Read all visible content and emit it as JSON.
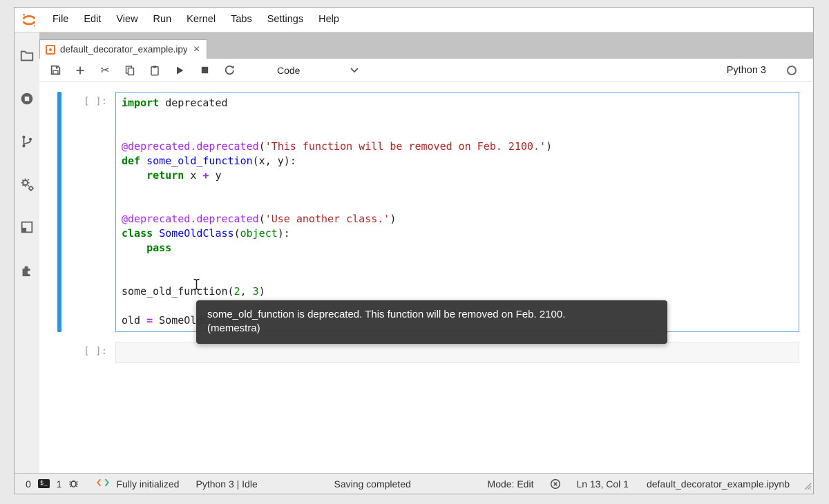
{
  "menubar": {
    "items": [
      "File",
      "Edit",
      "View",
      "Run",
      "Kernel",
      "Tabs",
      "Settings",
      "Help"
    ]
  },
  "tab": {
    "title": "default_decorator_example.ipynb",
    "close_label": "×"
  },
  "toolbar": {
    "cell_type": "Code",
    "kernel_name": "Python 3"
  },
  "cells": [
    {
      "prompt": "[ ]:",
      "lines": [
        [
          {
            "c": "kw",
            "v": "import"
          },
          {
            "c": "p",
            "v": " deprecated"
          }
        ],
        [],
        [],
        [
          {
            "c": "meta",
            "v": "@deprecated.deprecated"
          },
          {
            "c": "p",
            "v": "("
          },
          {
            "c": "str",
            "v": "'This function will be removed on Feb. 2100.'"
          },
          {
            "c": "p",
            "v": ")"
          }
        ],
        [
          {
            "c": "kw",
            "v": "def"
          },
          {
            "c": "p",
            "v": " "
          },
          {
            "c": "fn",
            "v": "some_old_function"
          },
          {
            "c": "p",
            "v": "(x, y):"
          }
        ],
        [
          {
            "c": "p",
            "v": "    "
          },
          {
            "c": "kw",
            "v": "return"
          },
          {
            "c": "p",
            "v": " x "
          },
          {
            "c": "op",
            "v": "+"
          },
          {
            "c": "p",
            "v": " y"
          }
        ],
        [],
        [],
        [
          {
            "c": "meta",
            "v": "@deprecated.deprecated"
          },
          {
            "c": "p",
            "v": "("
          },
          {
            "c": "str",
            "v": "'Use another class.'"
          },
          {
            "c": "p",
            "v": ")"
          }
        ],
        [
          {
            "c": "kw",
            "v": "class"
          },
          {
            "c": "p",
            "v": " "
          },
          {
            "c": "fn",
            "v": "SomeOldClass"
          },
          {
            "c": "p",
            "v": "("
          },
          {
            "c": "builtin",
            "v": "object"
          },
          {
            "c": "p",
            "v": "):"
          }
        ],
        [
          {
            "c": "p",
            "v": "    "
          },
          {
            "c": "kw",
            "v": "pass"
          }
        ],
        [],
        [],
        [
          {
            "c": "p",
            "v": "some_old_function("
          },
          {
            "c": "num",
            "v": "2"
          },
          {
            "c": "p",
            "v": ", "
          },
          {
            "c": "num",
            "v": "3"
          },
          {
            "c": "p",
            "v": ")"
          }
        ],
        [],
        [
          {
            "c": "p",
            "v": "old "
          },
          {
            "c": "op",
            "v": "="
          },
          {
            "c": "p",
            "v": " SomeOldClass()"
          }
        ]
      ]
    },
    {
      "prompt": "[ ]:",
      "lines": []
    }
  ],
  "tooltip": {
    "line1": "some_old_function is deprecated. This function will be removed on Feb. 2100.",
    "line2": "(memestra)"
  },
  "statusbar": {
    "terminals_count": "0",
    "terminal_glyph": "$_",
    "kernels_count": "1",
    "lsp_status": "Fully initialized",
    "kernel_status": "Python 3 | Idle",
    "saving_status": "Saving completed",
    "mode": "Mode: Edit",
    "cursor_position": "Ln 13, Col 1",
    "filename": "default_decorator_example.ipynb"
  },
  "colors": {
    "brand_orange": "#f37726",
    "active_cell_border": "#5fa8e6",
    "collapser_blue": "#2196f3",
    "tooltip_bg": "#363636"
  }
}
